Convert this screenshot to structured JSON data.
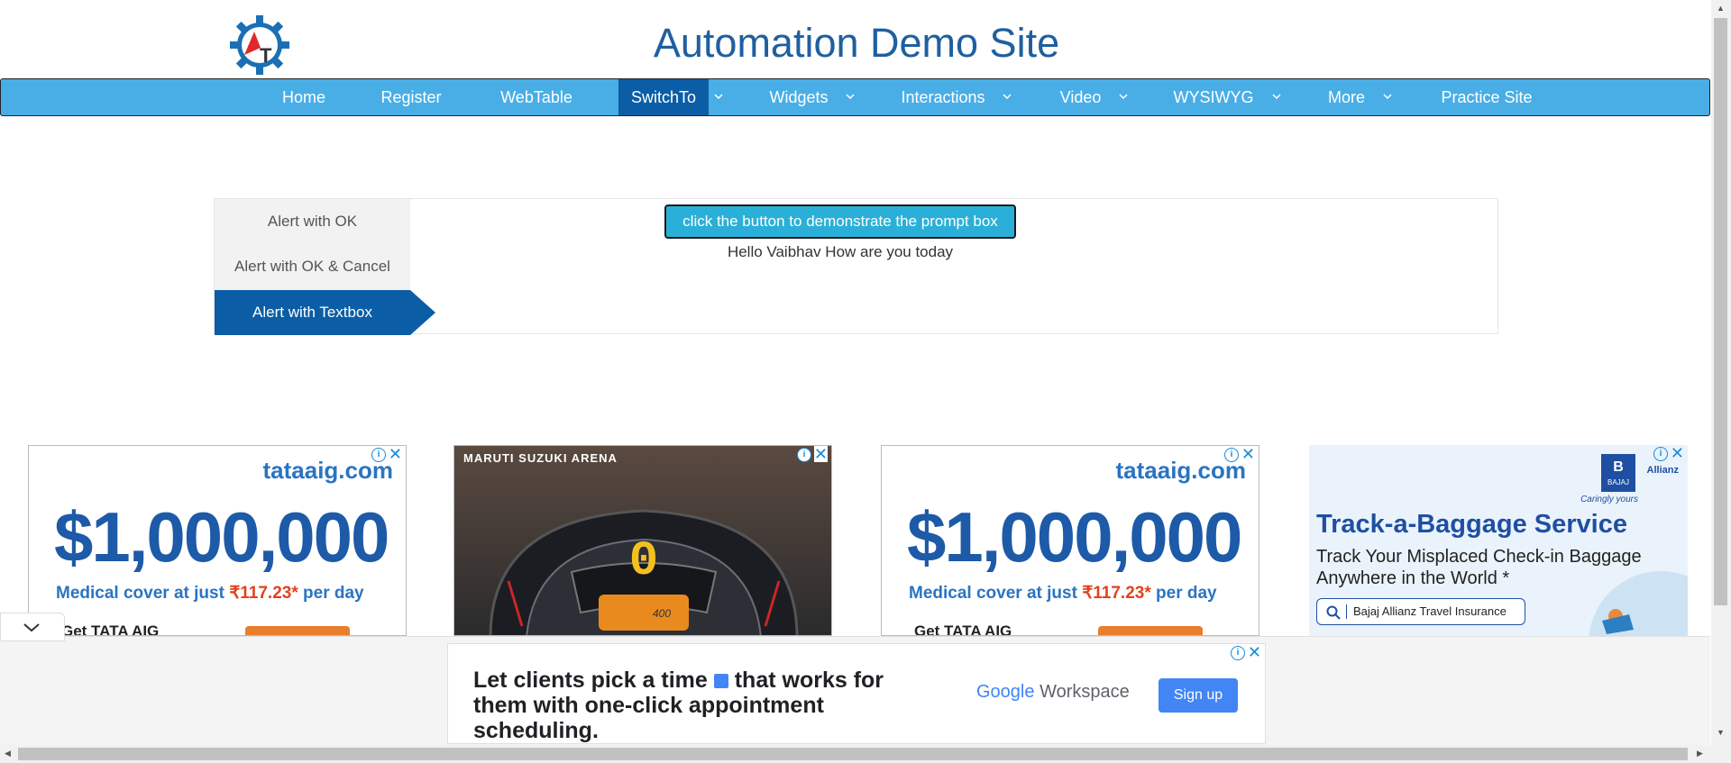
{
  "header": {
    "logo_icon": "automation-demo-logo",
    "logo_letters": "AT",
    "title": "Automation Demo Site"
  },
  "nav": {
    "items": [
      {
        "label": "Home"
      },
      {
        "label": "Register"
      },
      {
        "label": "WebTable"
      },
      {
        "label": "SwitchTo",
        "active": true,
        "has_dropdown": true
      },
      {
        "label": "Widgets",
        "has_dropdown": true
      },
      {
        "label": "Interactions",
        "has_dropdown": true
      },
      {
        "label": "Video",
        "has_dropdown": true
      },
      {
        "label": "WYSIWYG",
        "has_dropdown": true
      },
      {
        "label": "More",
        "has_dropdown": true
      },
      {
        "label": "Practice Site"
      }
    ]
  },
  "alerts": {
    "tabs": [
      {
        "label": "Alert with OK"
      },
      {
        "label": "Alert with OK & Cancel"
      },
      {
        "label": "Alert with Textbox",
        "active": true
      }
    ],
    "button_label": "click the button to demonstrate the prompt box",
    "result_text": "Hello Vaibhav How are you today"
  },
  "ads": {
    "tata_1": {
      "brand": "tataaig.com",
      "amount": "$1,000,000",
      "medical_prefix": "Medical cover at just ",
      "medical_rate": "₹117.23*",
      "medical_suffix": " per day",
      "cta": "Get TATA AIG"
    },
    "maruti": {
      "brand": "MARUTI SUZUKI ARENA",
      "speed": "0",
      "odometer": "400"
    },
    "tata_2": {
      "brand": "tataaig.com",
      "amount": "$1,000,000",
      "medical_prefix": "Medical cover at just ",
      "medical_rate": "₹117.23*",
      "medical_suffix": " per day",
      "cta": "Get TATA AIG"
    },
    "bajaj": {
      "logo_text": "BAJAJ",
      "partner": "Allianz",
      "tagline": "Caringly yours",
      "headline": "Track-a-Baggage Service",
      "sub": "Track Your Misplaced Check-in Baggage Anywhere in the World *",
      "search_text": "Bajaj Allianz Travel Insurance"
    },
    "info_icon": "info-icon",
    "close_icon": "close-icon"
  },
  "bottom_ad": {
    "text": "Let clients pick a time",
    "text2": "that works for them with one-click appointment scheduling.",
    "google": "Google",
    "workspace": "Workspace",
    "signup": "Sign up"
  },
  "colors": {
    "nav_bg": "#4aaee6",
    "nav_active": "#0b5ea6",
    "title": "#1f5fa0",
    "button": "#2ab0d8"
  }
}
